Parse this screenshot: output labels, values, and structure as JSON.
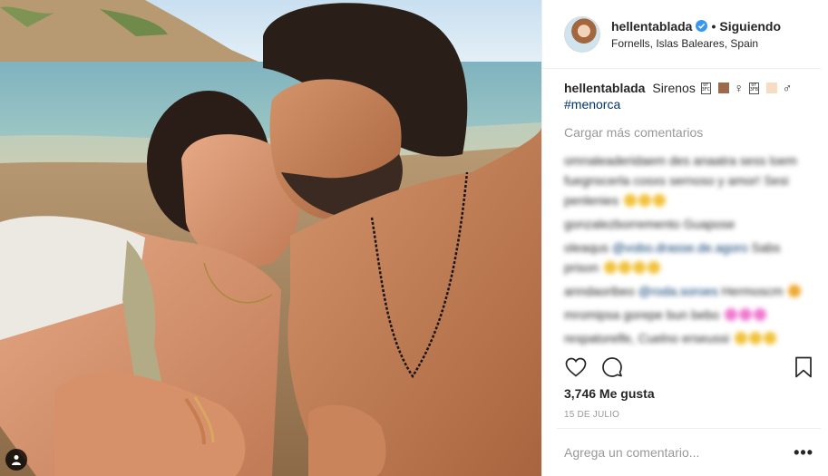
{
  "post": {
    "photo_description_alt": "",
    "user_tag_icon": "person-tag-icon"
  },
  "header": {
    "username": "hellentablada",
    "verified_icon": "verified-badge-icon",
    "separator": "•",
    "follow_status": "Siguiendo",
    "location": "Fornells, Islas Baleares, Spain"
  },
  "caption": {
    "username": "hellentablada",
    "text": "Sirenos",
    "hashtag": "#menorca",
    "female_symbol": "♀",
    "male_symbol": "♂"
  },
  "comments": {
    "load_more_label": "Cargar más comentarios",
    "blurred": [
      {
        "text": "omnaleaderidaem des anaatra sess loem",
        "link": "",
        "tail": "fuegnscerla cosxs sernoso y amor! Sesi penlenies",
        "emojis": 3
      },
      {
        "text": "gonzalezborremento Guapose",
        "link": "",
        "tail": "",
        "emojis": 0
      },
      {
        "text": "oleaqus",
        "link": "@vobo.drasse.de.agoro",
        "tail": "Sabs prison",
        "emojis": 5
      },
      {
        "text": "anndaoribeo",
        "link": "@roda.soroes",
        "tail": "Hermoscm",
        "emojis": 2
      },
      {
        "text": "mromipsa gorepe bun bebo",
        "link": "",
        "tail": "",
        "emojis": 3
      },
      {
        "text": "respatorelfe, Cuelno erseussi",
        "link": "",
        "tail": "",
        "emojis": 4
      }
    ]
  },
  "actions": {
    "like_icon": "heart-icon",
    "comment_icon": "comment-bubble-icon",
    "save_icon": "bookmark-icon"
  },
  "likes": "3,746 Me gusta",
  "date": "15 DE JULIO",
  "comment_input": {
    "placeholder": "Agrega un comentario...",
    "value": "",
    "more_label": "•••"
  },
  "colors": {
    "link": "#003569",
    "secondary_text": "#999999",
    "verified_blue": "#3897f0",
    "border": "#efefef"
  }
}
